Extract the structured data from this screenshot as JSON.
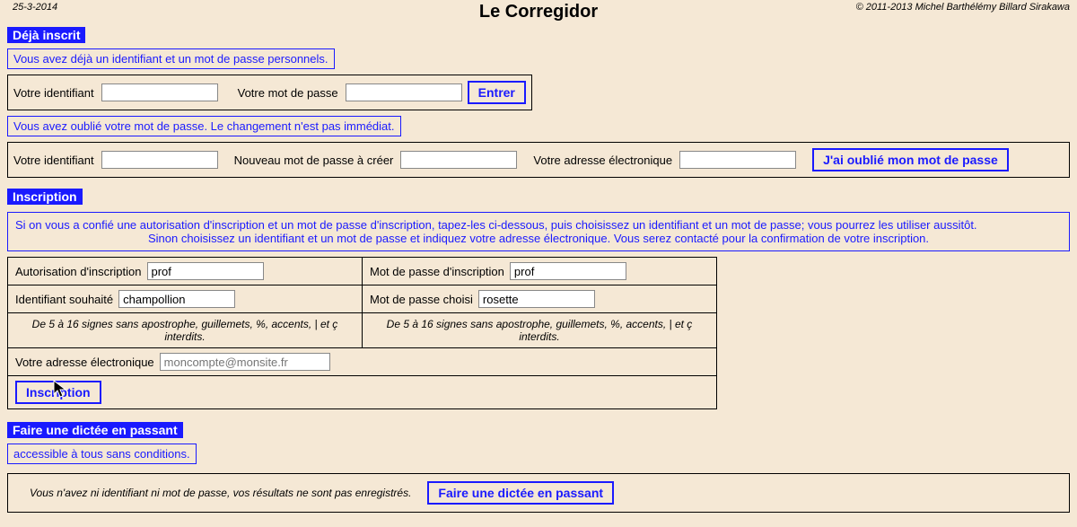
{
  "header": {
    "date": "25-3-2014",
    "title": "Le Corregidor",
    "copyright": "© 2011-2013 Michel Barthélémy Billard Sirakawa"
  },
  "deja": {
    "tag": "Déjà inscrit",
    "subtitle": "Vous avez déjà un identifiant et un mot de passe personnels.",
    "id_label": "Votre identifiant",
    "pw_label": "Votre mot de passe",
    "enter_btn": "Entrer"
  },
  "forgot": {
    "subtitle": "Vous avez oublié votre mot de passe. Le changement n'est pas immédiat.",
    "id_label": "Votre identifiant",
    "newpw_label": "Nouveau mot de passe à créer",
    "email_label": "Votre adresse électronique",
    "btn": "J'ai oublié mon mot de passe"
  },
  "inscription": {
    "tag": "Inscription",
    "line1": "Si on vous a confié une autorisation d'inscription et un mot de passe d'inscription, tapez-les ci-dessous, puis choisissez un identifiant et un mot de passe; vous pourrez les utiliser aussitôt.",
    "line2": "Sinon choisissez un identifiant et un mot de passe et indiquez votre adresse électronique. Vous serez contacté pour la confirmation de votre inscription.",
    "auth_label": "Autorisation d'inscription",
    "auth_value": "prof",
    "authpw_label": "Mot de passe d'inscription",
    "authpw_value": "prof",
    "wantid_label": "Identifiant souhaité",
    "wantid_value": "champollion",
    "wantpw_label": "Mot de passe choisi",
    "wantpw_value": "rosette",
    "hint": "De 5 à 16 signes sans apostrophe, guillemets, %, accents, | et ç interdits.",
    "email_label": "Votre adresse électronique",
    "email_placeholder": "moncompte@monsite.fr",
    "btn": "Inscription"
  },
  "passant": {
    "tag": "Faire une dictée en passant",
    "subtitle": "accessible à tous sans conditions.",
    "note": "Vous n'avez ni identifiant ni mot de passe, vos résultats ne sont pas enregistrés.",
    "btn": "Faire une dictée en passant"
  }
}
